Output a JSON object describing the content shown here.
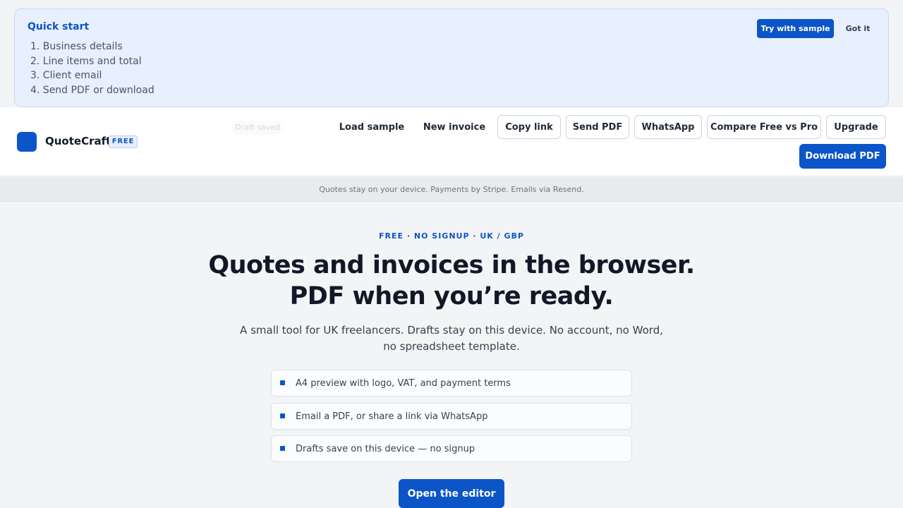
{
  "quick_start": {
    "title": "Quick start",
    "steps": [
      "1. Business details",
      "2. Line items and total",
      "3. Client email",
      "4. Send PDF or download"
    ],
    "try_sample_label": "Try with sample",
    "got_it_label": "Got it"
  },
  "header": {
    "brand": "QuoteCraft",
    "plan_badge": "FREE",
    "draft_status": "Draft saved",
    "actions": {
      "load_sample": "Load sample",
      "new_invoice": "New invoice",
      "copy_link": "Copy link",
      "send_pdf": "Send PDF",
      "whatsapp": "WhatsApp",
      "compare": "Compare Free vs Pro",
      "upgrade": "Upgrade",
      "download_pdf": "Download PDF"
    }
  },
  "notice": "Quotes stay on your device. Payments by Stripe. Emails via Resend.",
  "hero": {
    "eyebrow": "FREE · NO SIGNUP · UK / GBP",
    "headline": "Quotes and invoices in the browser. PDF when you’re ready.",
    "subhead": "A small tool for UK freelancers. Drafts stay on this device. No account, no Word, no spreadsheet template.",
    "features": [
      "A4 preview with logo, VAT, and payment terms",
      "Email a PDF, or share a link via WhatsApp",
      "Drafts save on this device — no signup"
    ],
    "cta_label": "Open the editor"
  },
  "colors": {
    "brand_blue": "#0b55c9",
    "banner_bg": "#e8effd",
    "page_bg": "#f3f4f6"
  }
}
